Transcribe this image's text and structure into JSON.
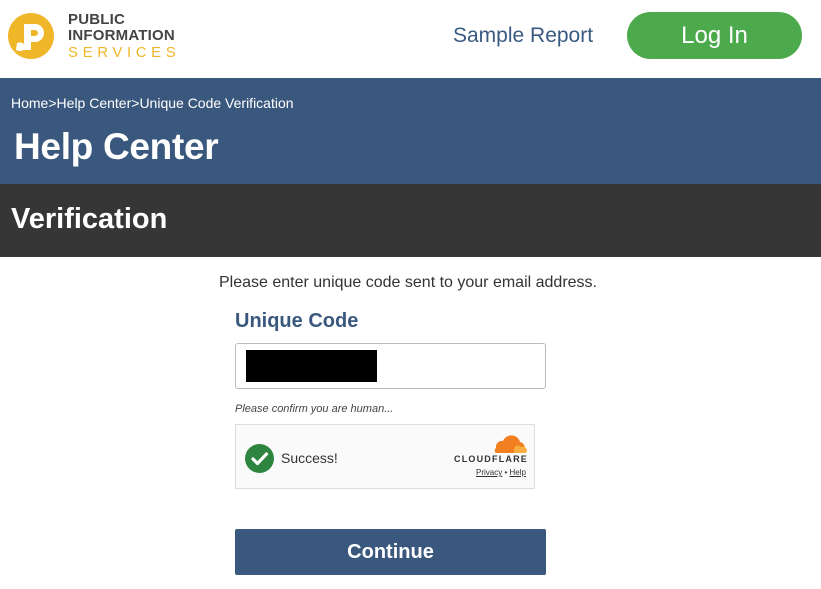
{
  "brand": {
    "line1": "PUBLIC",
    "line2": "INFORMATION",
    "line3": "SERVICES",
    "logo_icon": "pis-p-icon",
    "primary_color": "#f0b62a"
  },
  "nav": {
    "sample_report": "Sample Report",
    "login": "Log In",
    "login_color": "#4caa4c"
  },
  "breadcrumb": {
    "items": [
      "Home",
      "Help Center",
      "Unique Code Verification"
    ],
    "separator": ">"
  },
  "page": {
    "title": "Help Center",
    "section": "Verification",
    "band_color": "#3a587d",
    "section_band_color": "#363636"
  },
  "form": {
    "instructions": "Please enter unique code sent to your email address.",
    "code_label": "Unique Code",
    "human_prompt": "Please confirm you are human...",
    "continue": "Continue"
  },
  "captcha": {
    "status": "Success!",
    "check_icon": "check-circle-icon",
    "provider": "CLOUDFLARE",
    "provider_icon": "cloudflare-cloud-icon",
    "privacy": "Privacy",
    "link_sep": "•",
    "help": "Help"
  }
}
